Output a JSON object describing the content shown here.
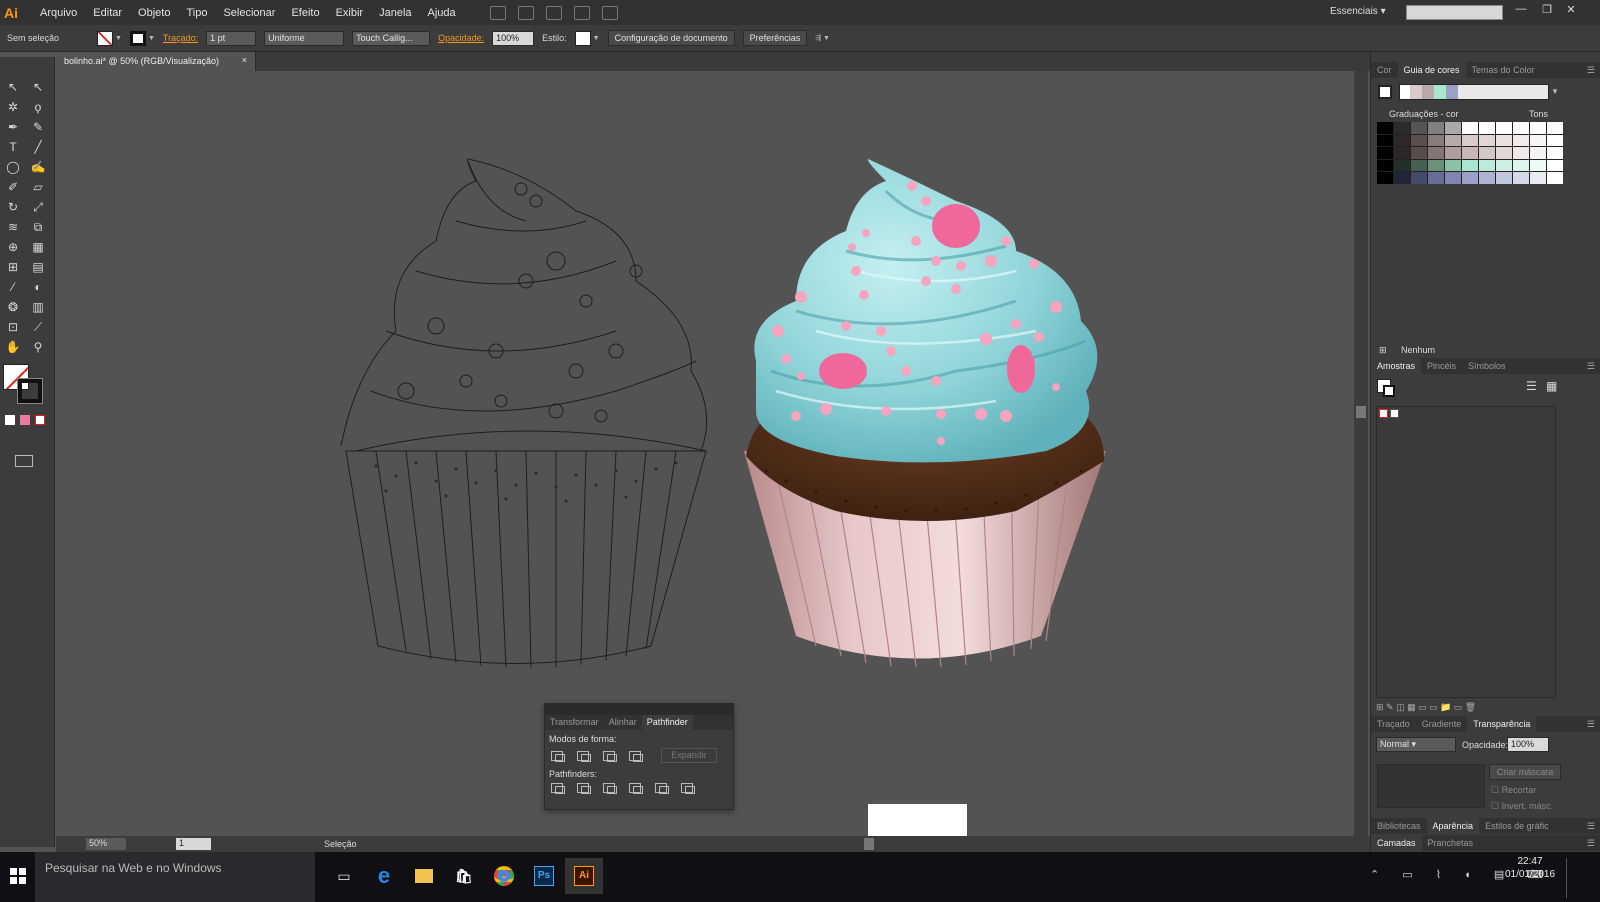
{
  "app": {
    "logo": "Ai"
  },
  "menu": [
    "Arquivo",
    "Editar",
    "Objeto",
    "Tipo",
    "Selecionar",
    "Efeito",
    "Exibir",
    "Janela",
    "Ajuda"
  ],
  "workspace": "Essenciais",
  "control": {
    "selection": "Sem seleção",
    "stroke_label": "Traçado:",
    "stroke_weight": "1 pt",
    "profile": "Uniforme",
    "brush": "Touch Callig...",
    "opacity_label": "Opacidade:",
    "opacity": "100%",
    "style_label": "Estilo:",
    "doc_setup": "Configuração de documento",
    "prefs": "Preferências"
  },
  "document": {
    "tab_title": "bolinho.ai* @ 50% (RGB/Visualização)",
    "close": "×"
  },
  "status": {
    "zoom": "50%",
    "page": "1",
    "tool": "Seleção"
  },
  "color_guide": {
    "tabs": [
      "Cor",
      "Guia de cores",
      "Temas do Color"
    ],
    "variation_label": "Graduações - cor",
    "tones_label": "Tons",
    "none_label": "Nenhum",
    "harmony_colors": [
      "#ffffff",
      "#d9cbc9",
      "#b9a9aa",
      "#a9e6cf",
      "#9aa0c6"
    ]
  },
  "swatches": {
    "tabs": [
      "Amostras",
      "Pincéis",
      "Símbolos"
    ]
  },
  "transparency": {
    "tabs": [
      "Traçado",
      "Gradiente",
      "Transparência"
    ],
    "blend_mode": "Normal",
    "opacity_label": "Opacidade:",
    "opacity": "100%",
    "make_mask": "Criar máscara",
    "clip": "Recortar",
    "invert": "Invert. másc."
  },
  "bottom_tabs": {
    "row1": [
      "Bibliotecas",
      "Aparência",
      "Estilos de gráfic"
    ],
    "row2": [
      "Camadas",
      "Pranchetas"
    ]
  },
  "pathfinder": {
    "tabs": [
      "Transformar",
      "Alinhar",
      "Pathfinder"
    ],
    "shape_modes_label": "Modos de forma:",
    "expand": "Expandir",
    "pathfinders_label": "Pathfinders:"
  },
  "taskbar": {
    "search_placeholder": "Pesquisar na Web e no Windows",
    "time": "22:47",
    "date": "01/01/2016"
  }
}
